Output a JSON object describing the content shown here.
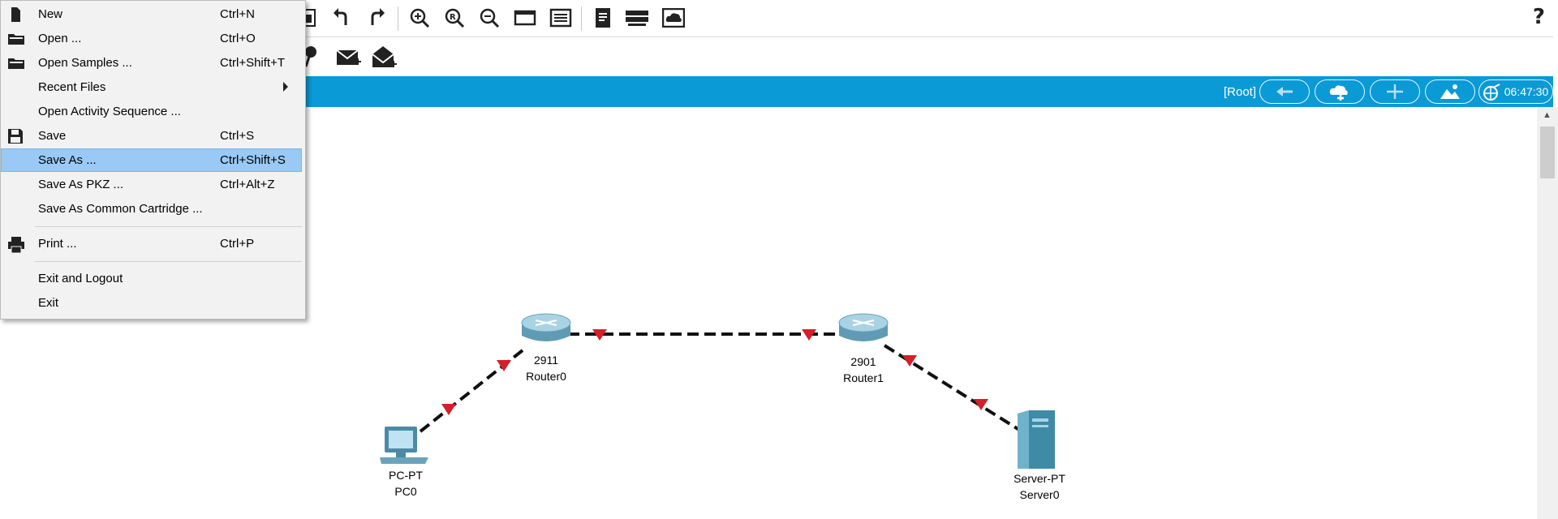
{
  "menu": {
    "items": [
      {
        "label": "New",
        "shortcut": "Ctrl+N",
        "icon": "new-file-icon"
      },
      {
        "label": "Open ...",
        "shortcut": "Ctrl+O",
        "icon": "folder-icon"
      },
      {
        "label": "Open Samples ...",
        "shortcut": "Ctrl+Shift+T",
        "icon": "folder-icon"
      },
      {
        "label": "Recent Files",
        "shortcut": "",
        "submenu": true
      },
      {
        "label": "Open Activity Sequence ...",
        "shortcut": ""
      },
      {
        "label": "Save",
        "shortcut": "Ctrl+S",
        "icon": "save-icon"
      },
      {
        "label": "Save As ...",
        "shortcut": "Ctrl+Shift+S",
        "selected": true
      },
      {
        "label": "Save As PKZ ...",
        "shortcut": "Ctrl+Alt+Z"
      },
      {
        "label": "Save As Common Cartridge ...",
        "shortcut": ""
      },
      {
        "label": "Print ...",
        "shortcut": "Ctrl+P",
        "icon": "printer-icon"
      },
      {
        "label": "Exit and Logout",
        "shortcut": ""
      },
      {
        "label": "Exit",
        "shortcut": ""
      }
    ]
  },
  "toolbar": {
    "help_label": "?",
    "icons": [
      "activity-wizard-icon",
      "undo-icon",
      "redo-icon",
      "zoom-in-icon",
      "zoom-reset-icon",
      "zoom-out-icon",
      "drawing-palette-icon",
      "custom-device-icon",
      "notes-icon",
      "cluster-icon",
      "cloud-view-icon",
      "note-tool-icon",
      "add-simple-pdu-icon",
      "add-complex-pdu-icon"
    ]
  },
  "workspace_bar": {
    "root_label": "[Root]",
    "clock": "06:47:30",
    "buttons": [
      "back-icon",
      "new-cluster-icon",
      "move-object-icon",
      "set-background-icon",
      "viewport-icon"
    ],
    "color": "#0a9ad6"
  },
  "topology": {
    "devices": [
      {
        "model": "2911",
        "name": "Router0",
        "type": "router-icon"
      },
      {
        "model": "2901",
        "name": "Router1",
        "type": "router-icon"
      },
      {
        "model": "PC-PT",
        "name": "PC0",
        "type": "pc-icon"
      },
      {
        "model": "Server-PT",
        "name": "Server0",
        "type": "server-icon"
      }
    ],
    "links": [
      {
        "from": "PC0",
        "to": "Router0",
        "style": "dashed"
      },
      {
        "from": "Router0",
        "to": "Router1",
        "style": "dashed"
      },
      {
        "from": "Router1",
        "to": "Server0",
        "style": "dashed"
      }
    ],
    "link_indicator_color": "#d3202a"
  }
}
